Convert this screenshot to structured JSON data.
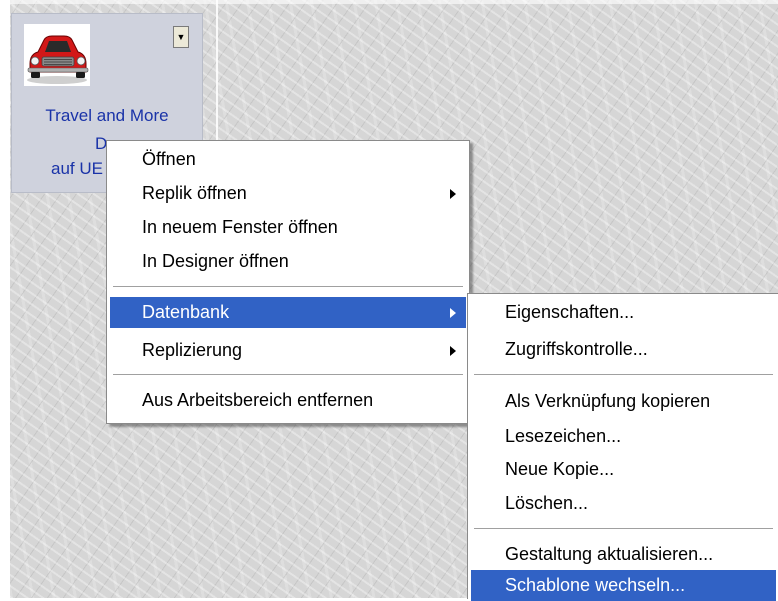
{
  "tile": {
    "title": "Travel and More",
    "line2": "De",
    "line3": "auf UE",
    "icon": "red-car-icon",
    "dropdown_icon": "dropdown-arrow-icon"
  },
  "context_menu": {
    "items": [
      {
        "label": "Öffnen"
      },
      {
        "label": "Replik öffnen"
      },
      {
        "label": "In neuem Fenster öffnen"
      },
      {
        "label": "In Designer öffnen"
      },
      {
        "label": "Datenbank"
      },
      {
        "label": "Replizierung"
      },
      {
        "label": "Aus Arbeitsbereich entfernen"
      }
    ]
  },
  "submenu": {
    "items": [
      {
        "label": "Eigenschaften..."
      },
      {
        "label": "Zugriffskontrolle..."
      },
      {
        "label": "Als Verknüpfung kopieren"
      },
      {
        "label": "Lesezeichen..."
      },
      {
        "label": "Neue Kopie..."
      },
      {
        "label": "Löschen..."
      },
      {
        "label": "Gestaltung aktualisieren..."
      },
      {
        "label": "Schablone wechseln..."
      }
    ]
  },
  "colors": {
    "highlight": "#3162c5",
    "tile_text": "#1a33a8",
    "tile_bg": "#cfd2dd"
  }
}
